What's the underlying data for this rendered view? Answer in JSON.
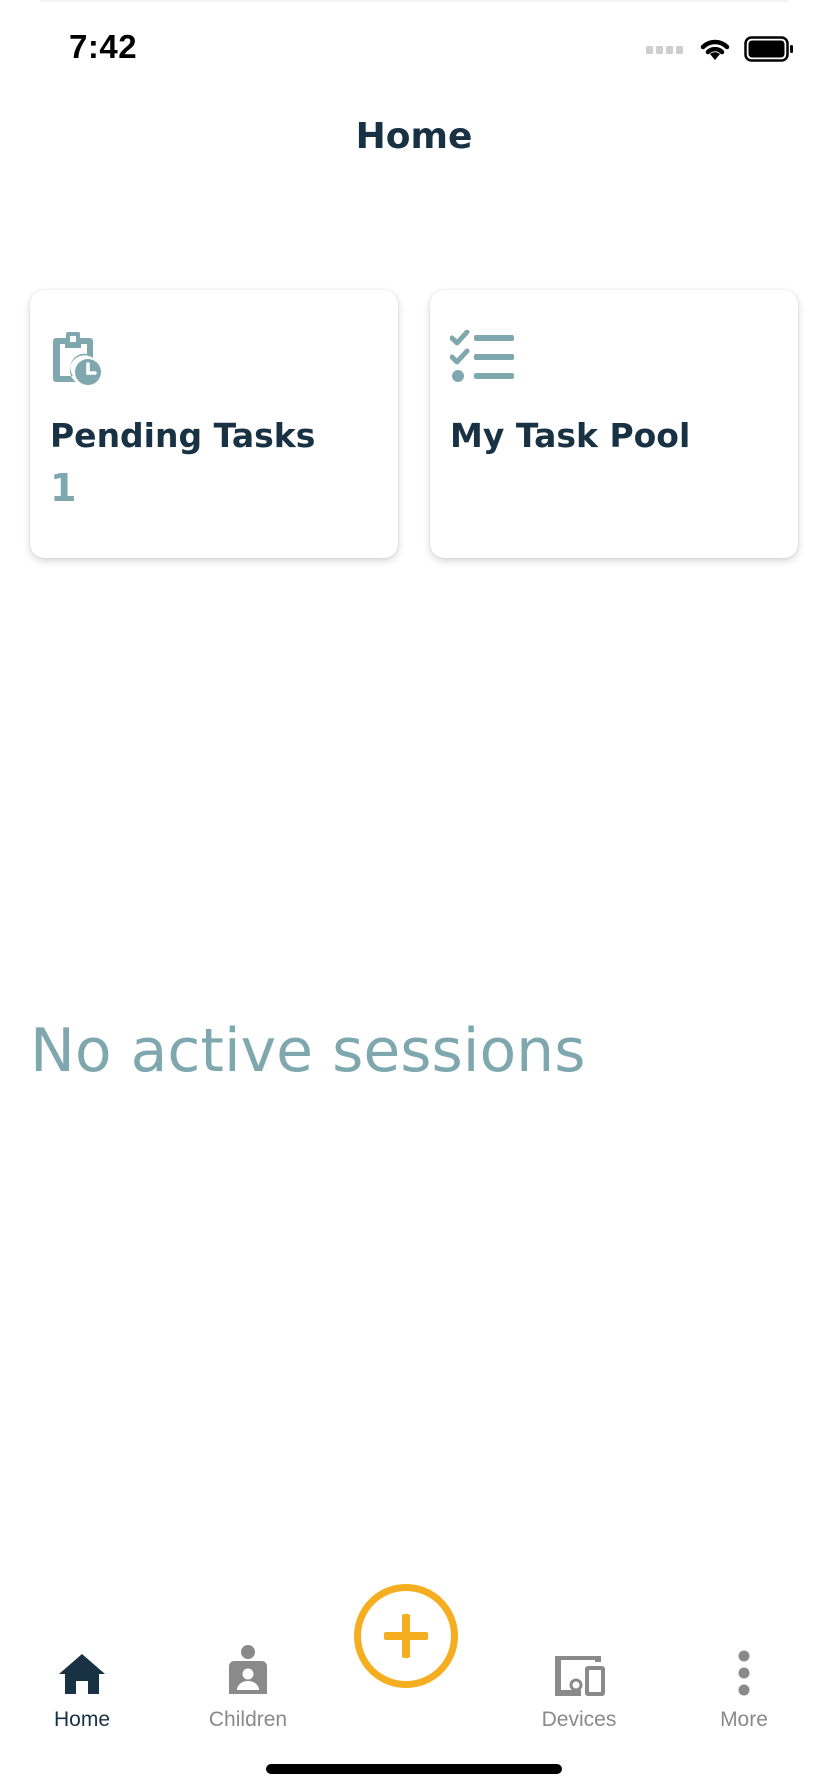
{
  "status_bar": {
    "time": "7:42"
  },
  "header": {
    "title": "Home"
  },
  "cards": [
    {
      "title": "Pending Tasks",
      "count": "1",
      "icon": "clipboard-clock-icon"
    },
    {
      "title": "My Task Pool",
      "icon": "checklist-icon"
    }
  ],
  "empty_state": {
    "text": "No active sessions"
  },
  "bottom_nav": {
    "items": [
      {
        "label": "Home",
        "icon": "home-icon",
        "active": true
      },
      {
        "label": "Children",
        "icon": "child-icon",
        "active": false
      },
      {
        "label": "Devices",
        "icon": "devices-icon",
        "active": false
      },
      {
        "label": "More",
        "icon": "more-vertical-icon",
        "active": false
      }
    ],
    "fab_icon": "plus-icon"
  },
  "colors": {
    "primary_dark": "#183244",
    "accent_teal": "#7fa8ae",
    "fab_orange": "#f5ae1f",
    "inactive_gray": "#8a8a8a"
  }
}
